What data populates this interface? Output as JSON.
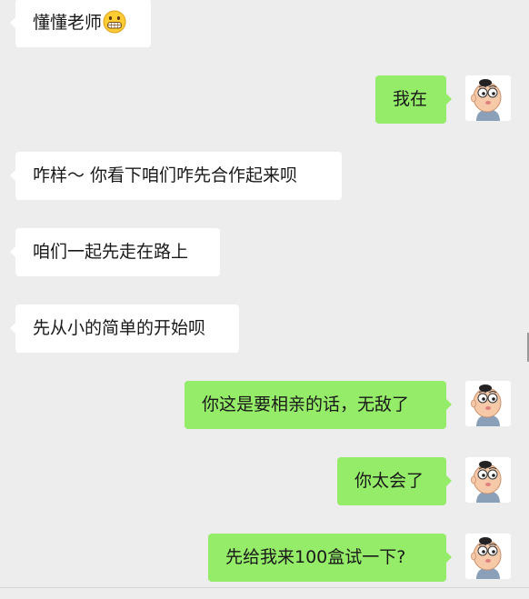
{
  "messages": [
    {
      "side": "left",
      "text": "懂懂老师",
      "emoji": "grinning-face-icon"
    },
    {
      "side": "right",
      "text": "我在"
    },
    {
      "side": "left",
      "text": "咋样～ 你看下咱们咋先合作起来呗"
    },
    {
      "side": "left",
      "text": "咱们一起先走在路上"
    },
    {
      "side": "left",
      "text": "先从小的简单的开始呗"
    },
    {
      "side": "right",
      "text": "你这是要相亲的话，无敌了"
    },
    {
      "side": "right",
      "text": "你太会了"
    },
    {
      "side": "right",
      "text": "先给我来100盒试一下?"
    }
  ],
  "colors": {
    "background": "#ededed",
    "left_bubble": "#ffffff",
    "right_bubble": "#95ec69",
    "text": "#191919"
  }
}
